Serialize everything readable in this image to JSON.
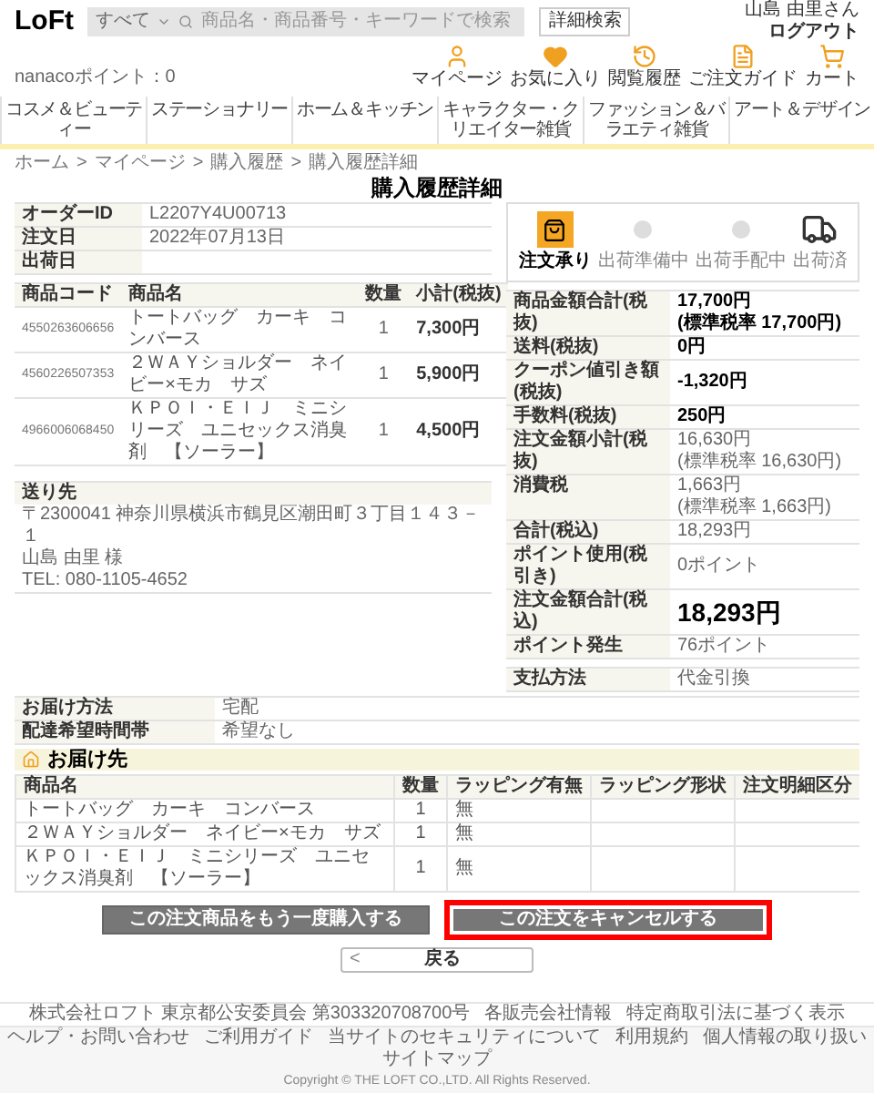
{
  "header": {
    "logo": "LoFt",
    "search": {
      "category": "すべて",
      "placeholder": "商品名・商品番号・キーワードで検索",
      "button": "詳細検索"
    },
    "user": {
      "name": "山島 由里さん",
      "logout": "ログアウト",
      "points": "nanacoポイント：0"
    },
    "icons": [
      {
        "kind": "user",
        "label": "マイページ"
      },
      {
        "kind": "heart",
        "label": "お気に入り"
      },
      {
        "kind": "history",
        "label": "閲覧履歴"
      },
      {
        "kind": "guide",
        "label": "ご注文ガイド"
      },
      {
        "kind": "cart",
        "label": "カート"
      }
    ]
  },
  "nav": [
    "コスメ＆ビューティー",
    "ステーショナリー",
    "ホーム＆キッチン",
    "キャラクター・クリエイター雑貨",
    "ファッション＆バラエティ雑貨",
    "アート＆デザイン"
  ],
  "breadcrumb": [
    {
      "label": "ホーム"
    },
    {
      "separator": ">",
      "label": "マイページ"
    },
    {
      "separator": ">",
      "label": "購入履歴"
    },
    {
      "separator": ">",
      "label": "購入履歴詳細"
    }
  ],
  "title": "購入履歴詳細",
  "order_info": [
    {
      "label": "オーダーID",
      "value": "L2207Y4U00713"
    },
    {
      "label": "注文日",
      "value": "2022年07月13日"
    },
    {
      "label": "出荷日"
    }
  ],
  "status_steps": [
    {
      "kind": "bag",
      "label": "注文承り",
      "selected": true
    },
    {
      "kind": "dot",
      "label": "出荷準備中",
      "selected": false
    },
    {
      "kind": "dot",
      "label": "出荷手配中",
      "selected": false
    },
    {
      "kind": "truck",
      "label": "出荷済",
      "selected": false
    }
  ],
  "items": {
    "columns": [
      "商品コード",
      "商品名",
      "数量",
      "小計(税抜)"
    ],
    "rows": [
      [
        "4550263606656",
        "トートバッグ　カーキ　コンバース",
        "1",
        "7,300円"
      ],
      [
        "4560226507353",
        "２ＷＡＹショルダー　ネイビー×モカ　サズ",
        "1",
        "5,900円"
      ],
      [
        "4966006068450",
        "ＫＰＯＩ・ＥＩＪ　ミニシリーズ　ユニセックス消臭剤　【ソーラー】",
        "1",
        "4,500円"
      ]
    ]
  },
  "summary": [
    {
      "label": "商品金額合計(税抜)",
      "kind": "bold",
      "lines": [
        "17,700円",
        "(標準税率 17,700円)"
      ]
    },
    {
      "label": "送料(税抜)",
      "kind": "bold",
      "lines": [
        "0円"
      ]
    },
    {
      "label": "クーポン値引き額(税抜)",
      "kind": "bold",
      "lines": [
        "-1,320円"
      ]
    },
    {
      "label": "手数料(税抜)",
      "kind": "bold",
      "lines": [
        "250円"
      ]
    },
    {
      "label": "注文金額小計(税抜)",
      "kind": "plain",
      "lines": [
        "16,630円",
        "(標準税率 16,630円)"
      ]
    },
    {
      "label": "消費税",
      "kind": "plain",
      "lines": [
        "1,663円",
        "(標準税率 1,663円)"
      ]
    },
    {
      "label": "合計(税込)",
      "kind": "plain",
      "lines": [
        "18,293円"
      ]
    },
    {
      "label": "ポイント使用(税引き)",
      "kind": "plain",
      "lines": [
        "0ポイント"
      ]
    },
    {
      "label": "注文金額合計(税込)",
      "kind": "large",
      "lines": [
        "18,293円"
      ]
    },
    {
      "label": "ポイント発生",
      "kind": "plain",
      "lines": [
        "76ポイント"
      ]
    }
  ],
  "payment": {
    "label": "支払方法",
    "value": "代金引換"
  },
  "address": {
    "label": "送り先",
    "lines": [
      "〒2300041 神奈川県横浜市鶴見区潮田町３丁目１４３－１",
      "山島 由里 様",
      "TEL: 080-1105-4652"
    ]
  },
  "delivery": [
    {
      "label": "お届け方法",
      "value": "宅配"
    },
    {
      "label": "配達希望時間帯",
      "value": "希望なし"
    }
  ],
  "ship_heading": "お届け先",
  "ship_table": {
    "columns": [
      "商品名",
      "数量",
      "ラッピング有無",
      "ラッピング形状",
      "注文明細区分"
    ],
    "rows": [
      [
        "トートバッグ　カーキ　コンバース",
        "1",
        "無"
      ],
      [
        "２ＷＡＹショルダー　ネイビー×モカ　サズ",
        "1",
        "無"
      ],
      [
        "ＫＰＯＩ・ＥＩＪ　ミニシリーズ　ユニセックス消臭剤　【ソーラー】",
        "1",
        "無"
      ]
    ]
  },
  "actions": [
    {
      "label": "この注文商品をもう一度購入する",
      "highlighted": false
    },
    {
      "label": "この注文をキャンセルする",
      "highlighted": true
    }
  ],
  "back": {
    "icon": "<",
    "label": "戻る"
  },
  "footer": {
    "info": [
      "株式会社ロフト 東京都公安委員会 第303320708700号",
      "各販売会社情報",
      "特定商取引法に基づく表示"
    ],
    "links": [
      "ヘルプ・お問い合わせ",
      "ご利用ガイド",
      "当サイトのセキュリティについて",
      "利用規約",
      "個人情報の取り扱い",
      "サイトマップ"
    ],
    "copyright": "Copyright © THE LOFT CO.,LTD. All Rights Reserved."
  }
}
